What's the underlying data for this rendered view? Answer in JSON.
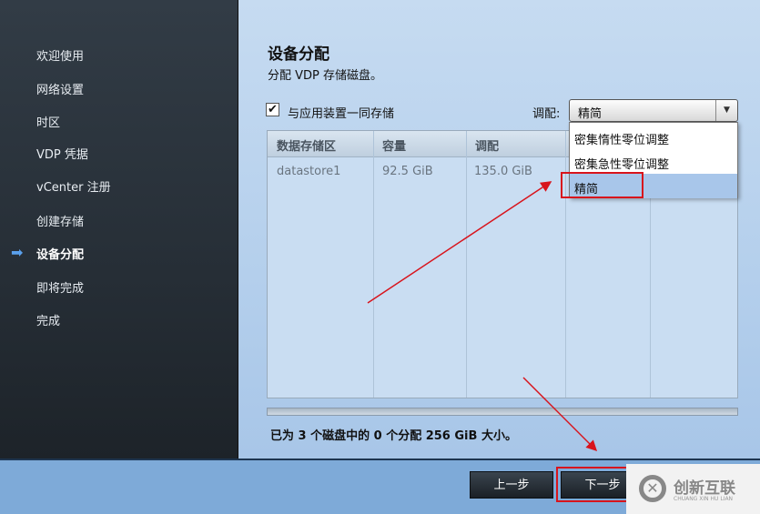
{
  "sidebar": {
    "items": [
      "欢迎使用",
      "网络设置",
      "时区",
      "VDP 凭据",
      "vCenter 注册",
      "创建存储",
      "设备分配",
      "即将完成",
      "完成"
    ],
    "active_index": 6
  },
  "main": {
    "title": "设备分配",
    "subtitle": "分配 VDP 存储磁盘。",
    "checkbox_label": "与应用装置一同存储",
    "checkbox_checked": true,
    "alloc_label": "调配:",
    "alloc_value": "精简",
    "alloc_options": [
      "密集惰性零位调整",
      "密集急性零位调整",
      "精简"
    ],
    "table": {
      "headers": [
        "数据存储区",
        "容量",
        "调配"
      ],
      "rows": [
        [
          "datastore1",
          "92.5 GiB",
          "135.0 GiB"
        ]
      ]
    },
    "summary": "已为 3 个磁盘中的 0 个分配 256 GiB 大小。"
  },
  "footer": {
    "back": "上一步",
    "next": "下一步"
  },
  "watermark": {
    "text": "创新互联",
    "sub": "CHUANG XIN HU LIAN"
  },
  "colors": {
    "annotation": "#d8141c",
    "highlight": "#a8c6ea"
  }
}
